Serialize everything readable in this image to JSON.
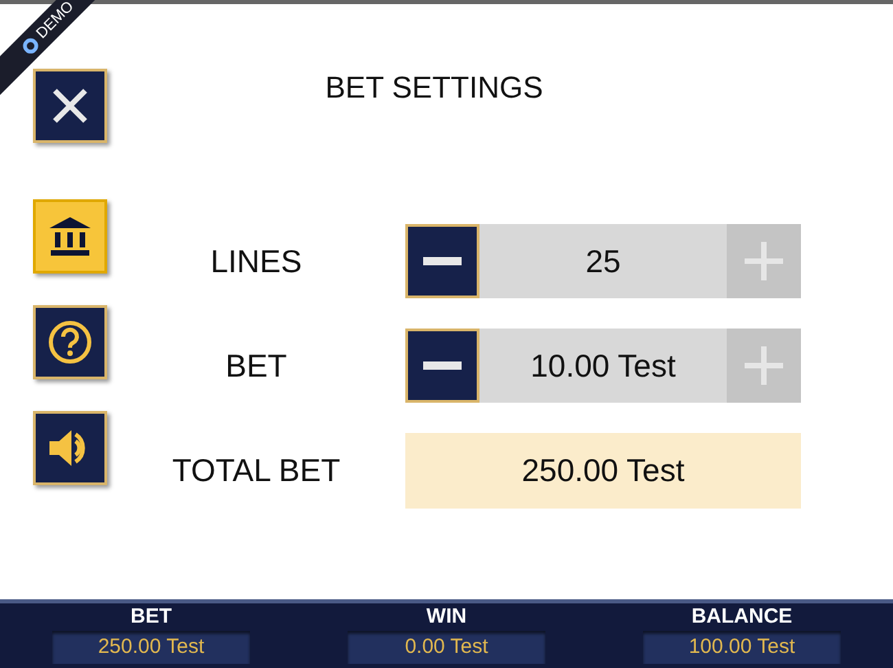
{
  "ribbon": {
    "label": "DEMO"
  },
  "title": "BET SETTINGS",
  "side_buttons": [
    {
      "kind": "close",
      "selected": false
    },
    {
      "kind": "paytable",
      "selected": true
    },
    {
      "kind": "help",
      "selected": false
    },
    {
      "kind": "sound",
      "selected": false
    }
  ],
  "steppers": [
    {
      "label": "LINES",
      "value": "25",
      "minus_disabled": false,
      "plus_disabled": true
    },
    {
      "label": "BET",
      "value": "10.00 Test",
      "minus_disabled": false,
      "plus_disabled": true
    }
  ],
  "total": {
    "label": "TOTAL BET",
    "value": "250.00 Test"
  },
  "status_bar": [
    {
      "label": "BET",
      "value": "250.00 Test"
    },
    {
      "label": "WIN",
      "value": "0.00 Test"
    },
    {
      "label": "BALANCE",
      "value": "100.00 Test"
    }
  ]
}
